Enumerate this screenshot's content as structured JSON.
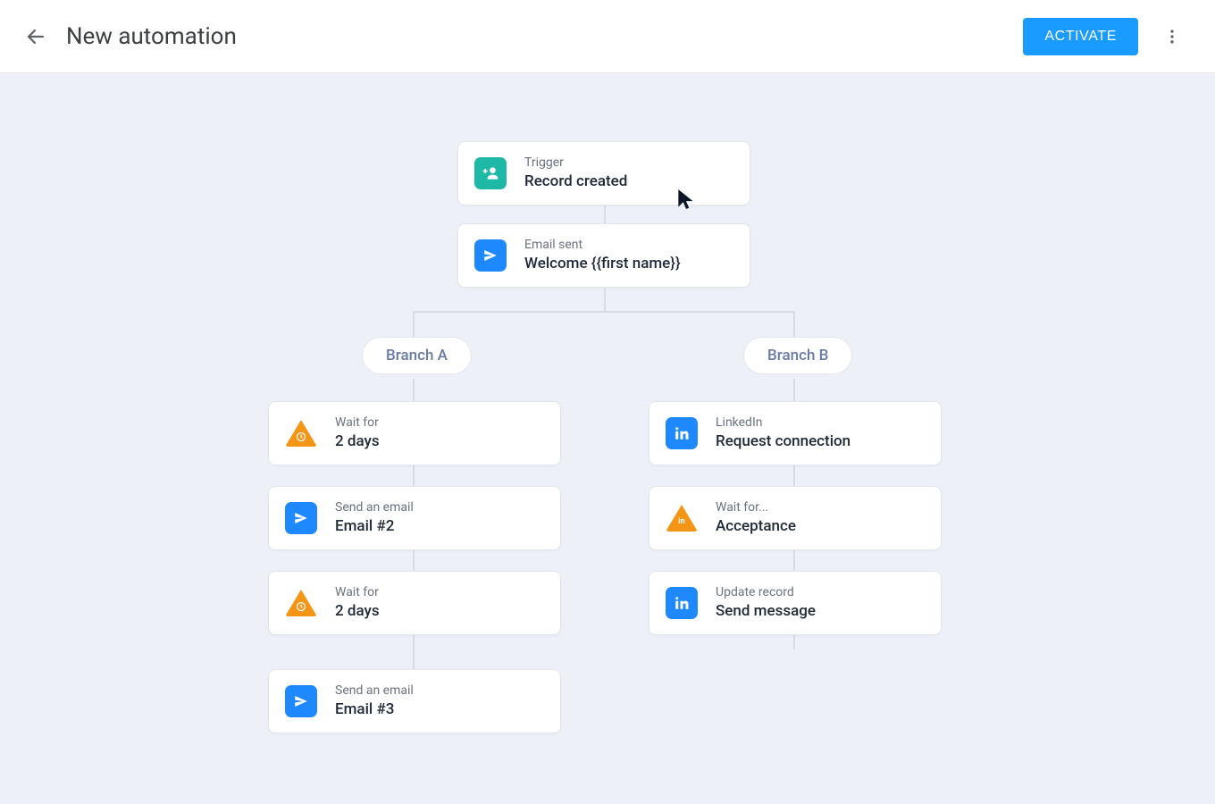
{
  "header": {
    "title": "New automation",
    "activate_label": "ACTIVATE"
  },
  "nodes": {
    "trigger": {
      "sub": "Trigger",
      "title": "Record created"
    },
    "email1": {
      "sub": "Email sent",
      "title": "Welcome {{first name}}"
    },
    "branchA": "Branch A",
    "branchB": "Branch B",
    "a1": {
      "sub": "Wait for",
      "title": "2 days"
    },
    "a2": {
      "sub": "Send an email",
      "title": "Email #2"
    },
    "a3": {
      "sub": "Wait for",
      "title": "2 days"
    },
    "a4": {
      "sub": "Send an email",
      "title": "Email #3"
    },
    "b1": {
      "sub": "LinkedIn",
      "title": "Request connection"
    },
    "b2": {
      "sub": "Wait for...",
      "title": "Acceptance"
    },
    "b3": {
      "sub": "Update record",
      "title": "Send message"
    }
  }
}
